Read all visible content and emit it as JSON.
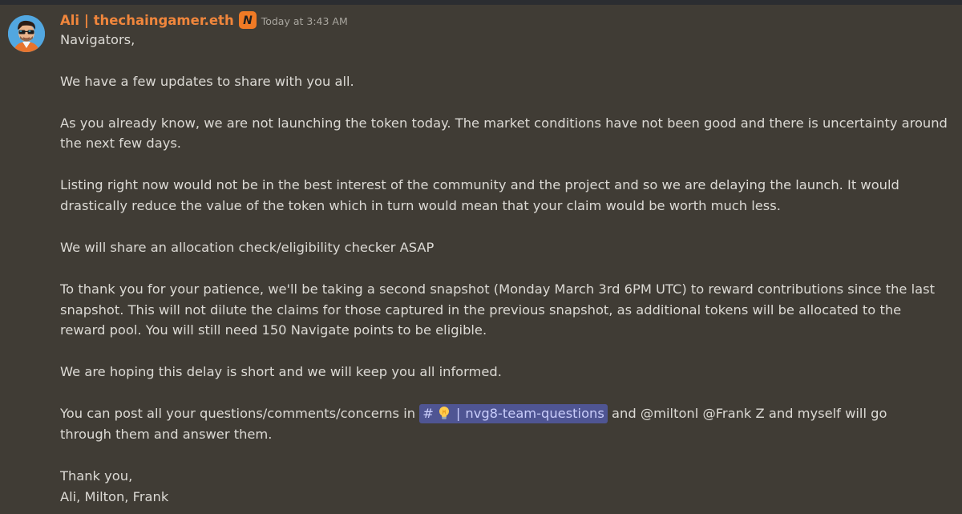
{
  "author": {
    "name": "Ali | thechaingamer.eth",
    "badge_letter": "N",
    "timestamp": "Today at 3:43 AM",
    "name_color": "#f0863c"
  },
  "icons": [
    "avatar",
    "role-badge-icon",
    "channel-hash-icon",
    "lightbulb-icon"
  ],
  "message": {
    "greeting": "Navigators,",
    "p1": "We have a few updates to share with you all.",
    "p2_line1": "As you already know, we are not launching the token today. The market conditions have not been good and there is uncertainty around",
    "p2_line2": "the next few days.",
    "p3_line1": "Listing right now would not be in the best interest of the community and the project and so we are delaying the launch. It would",
    "p3_line2": "drastically reduce the value of the token which in turn would mean that your claim would be worth much less.",
    "p4": "We will share an allocation check/eligibility checker ASAP",
    "p5_line1": "To thank you for your patience, we'll be taking a second snapshot (Monday March 3rd 6PM UTC) to reward contributions since the last",
    "p5_line2": "snapshot. This will not dilute the claims for those captured in the previous snapshot, as additional tokens will be allocated to the",
    "p5_line3": "reward pool. You will still need 150 Navigate points to be eligible.",
    "p6": "We are hoping this delay is short and we will keep you all informed.",
    "p7_prefix": "You can post all your questions/comments/concerns in",
    "channel_hash": "#",
    "channel_sep": "|",
    "channel_name": "nvg8-team-questions",
    "p7_and": "and",
    "mention_milton": "@miltonl",
    "mention_frank": "@Frank Z",
    "p7_suffix": "and myself will go",
    "p7_line2": "through them and answer them.",
    "signoff1": "Thank you,",
    "signoff2": "Ali, Milton, Frank"
  }
}
